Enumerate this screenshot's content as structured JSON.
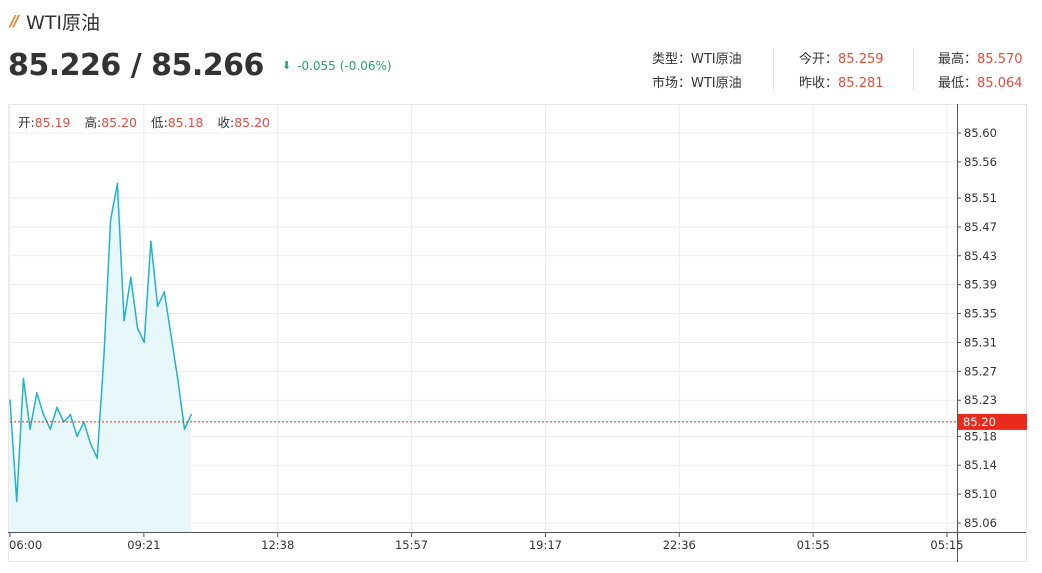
{
  "header": {
    "icon": "double-slash-logo-icon",
    "title": "WTI原油",
    "price": "85.226 / 85.266",
    "change": "-0.055",
    "change_pct": "(-0.06%)",
    "change_direction": "down",
    "change_color": "#2aa56c"
  },
  "stats": {
    "type_label": "类型：",
    "type_value": "WTI原油",
    "market_label": "市场：",
    "market_value": "WTI原油",
    "open_label": "今开：",
    "open_value": "85.259",
    "prev_close_label": "昨收：",
    "prev_close_value": "85.281",
    "high_label": "最高：",
    "high_value": "85.570",
    "low_label": "最低：",
    "low_value": "85.064"
  },
  "ohlc": {
    "open_label": "开:",
    "open": "85.19",
    "high_label": "高:",
    "high": "85.20",
    "low_label": "低:",
    "low": "85.18",
    "close_label": "收:",
    "close": "85.20"
  },
  "colors": {
    "line": "#1fb3cc",
    "area": "#e8f8fa",
    "price_up": "#e64b3c",
    "current_tag": "#e8291c"
  },
  "chart_data": {
    "type": "area",
    "x_tick_labels": [
      "06:00",
      "09:21",
      "12:38",
      "15:57",
      "19:17",
      "22:36",
      "01:55",
      "05:15"
    ],
    "x": [
      "06:00",
      "06:10",
      "06:20",
      "06:30",
      "06:40",
      "06:50",
      "07:00",
      "07:10",
      "07:20",
      "07:30",
      "07:40",
      "07:50",
      "08:00",
      "08:10",
      "08:20",
      "08:30",
      "08:40",
      "08:50",
      "09:00",
      "09:10",
      "09:20",
      "09:30",
      "09:40",
      "09:50",
      "10:00",
      "10:10",
      "10:20",
      "10:30"
    ],
    "values": [
      85.23,
      85.09,
      85.26,
      85.19,
      85.24,
      85.21,
      85.19,
      85.22,
      85.2,
      85.21,
      85.18,
      85.2,
      85.17,
      85.15,
      85.29,
      85.48,
      85.53,
      85.34,
      85.4,
      85.33,
      85.31,
      85.45,
      85.36,
      85.38,
      85.32,
      85.26,
      85.19,
      85.21
    ],
    "series": [
      {
        "name": "WTI原油"
      }
    ],
    "y_ticks": [
      "85.60",
      "85.56",
      "85.51",
      "85.47",
      "85.43",
      "85.39",
      "85.35",
      "85.31",
      "85.27",
      "85.23",
      "85.18",
      "85.14",
      "85.10",
      "85.06"
    ],
    "ylim": [
      85.05,
      85.62
    ],
    "current_price": "85.20",
    "current_value": 85.2,
    "grid": true
  }
}
